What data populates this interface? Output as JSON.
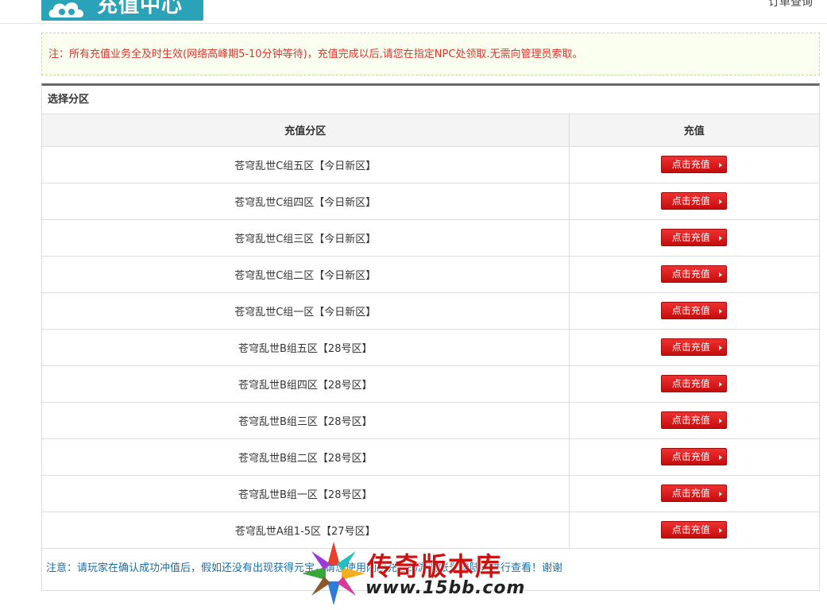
{
  "header": {
    "logo_text": "充值中心",
    "order_link": "订单查询"
  },
  "notice": "注：所有充值业务全及时生效(网络高峰期5-10分钟等待)，充值完成以后,请您在指定NPC处领取.无需向管理员索取。",
  "panel": {
    "title": "选择分区",
    "columns": [
      "充值分区",
      "充值"
    ],
    "button_label": "点击充值",
    "rows": [
      "苍穹乱世C组五区【今日新区】",
      "苍穹乱世C组四区【今日新区】",
      "苍穹乱世C组三区【今日新区】",
      "苍穹乱世C组二区【今日新区】",
      "苍穹乱世C组一区【今日新区】",
      "苍穹乱世B组五区【28号区】",
      "苍穹乱世B组四区【28号区】",
      "苍穹乱世B组三区【28号区】",
      "苍穹乱世B组二区【28号区】",
      "苍穹乱世B组一区【28号区】",
      "苍穹乱世A组1-5区【27号区】"
    ],
    "footer_note": "注意：请玩家在确认成功冲值后，假如还没有出现获得元宝，请您使用刚刚充值的游戏帐号登陆，进行查看！谢谢"
  },
  "watermark": {
    "title": "传奇版本库",
    "url": "www.15bb.com"
  },
  "colors": {
    "brand": "#2aa3b8",
    "notice_text": "#e0322b",
    "button": "#d81a1a",
    "footer_text": "#1a6fa8"
  }
}
